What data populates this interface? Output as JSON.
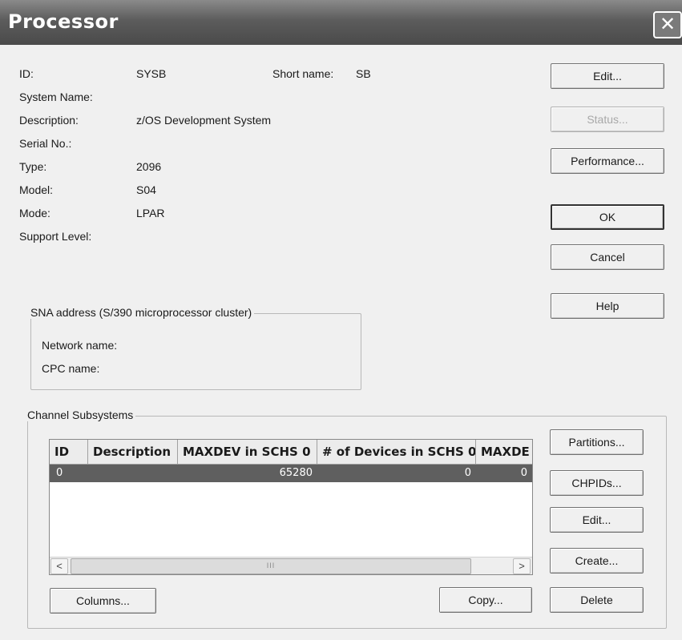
{
  "window": {
    "title": "Processor",
    "close_glyph": "✕"
  },
  "fields": {
    "id_label": "ID:",
    "id_value": "SYSB",
    "short_name_label": "Short name:",
    "short_name_value": "SB",
    "system_name_label": "System Name:",
    "description_label": "Description:",
    "description_value": "z/OS Development System",
    "serial_label": "Serial No.:",
    "type_label": "Type:",
    "type_value": "2096",
    "model_label": "Model:",
    "model_value": "S04",
    "mode_label": "Mode:",
    "mode_value": "LPAR",
    "support_label": "Support Level:"
  },
  "buttons": {
    "edit": "Edit...",
    "status": "Status...",
    "performance": "Performance...",
    "ok": "OK",
    "cancel": "Cancel",
    "help": "Help"
  },
  "sna": {
    "group_title": "SNA address (S/390 microprocessor cluster)",
    "network_label": "Network name:",
    "cpc_label": "CPC name:"
  },
  "channel_subsystems": {
    "group_title": "Channel Subsystems",
    "columns": [
      "ID",
      "Description",
      "MAXDEV in SCHS 0",
      "# of Devices in SCHS 0",
      "MAXDE"
    ],
    "rows": [
      {
        "id": "0",
        "description": "",
        "maxdev": "65280",
        "devices": "0",
        "maxde": "0"
      }
    ],
    "scroll_left": "<",
    "scroll_right": ">",
    "scroll_thumb": "III",
    "buttons": {
      "partitions": "Partitions...",
      "chpids": "CHPIDs...",
      "edit": "Edit...",
      "create": "Create...",
      "delete": "Delete",
      "columns": "Columns...",
      "copy": "Copy..."
    }
  },
  "colors": {
    "title_bar": "#5c5c5c",
    "selected_row": "#5f5f5f",
    "dialog_bg": "#f0f0f0"
  }
}
